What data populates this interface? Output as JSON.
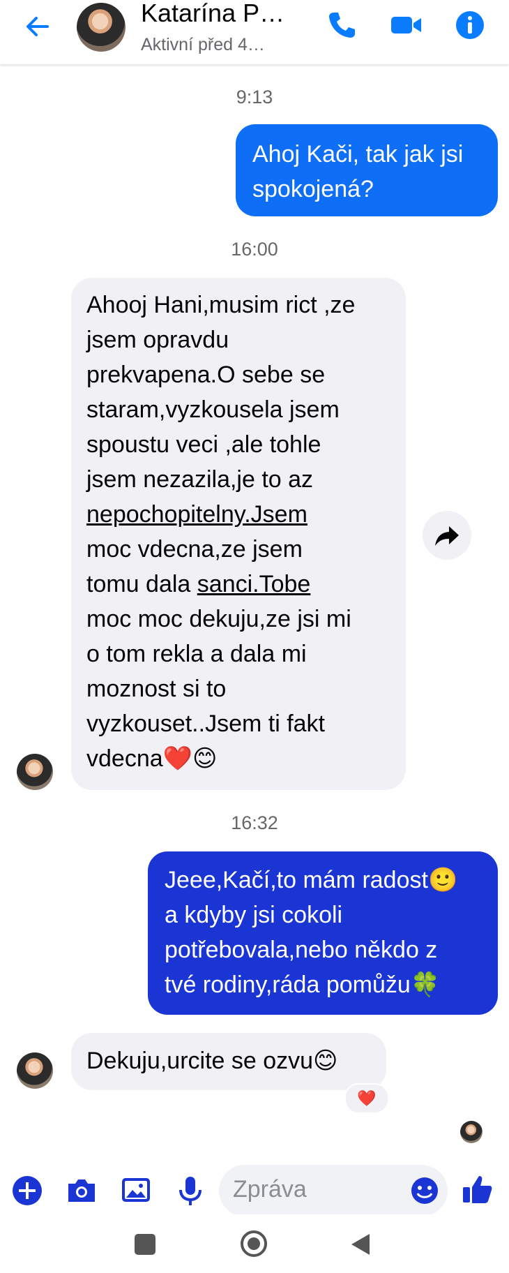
{
  "header": {
    "contact_name": "Katarína P…",
    "status": "Aktivní před 4…",
    "icons": [
      "back-arrow-icon",
      "phone-icon",
      "video-camera-icon",
      "info-icon"
    ],
    "accent_color": "#0a7cff"
  },
  "messages": [
    {
      "timestamp": "9:13"
    },
    {
      "direction": "outgoing",
      "lines": [
        "Ahoj Kači, tak jak jsi",
        "spokojená?"
      ]
    },
    {
      "timestamp": "16:00"
    },
    {
      "direction": "incoming",
      "lines": [
        "Ahooj Hani,musim rict ,ze",
        "jsem opravdu",
        "prekvapena.O sebe se",
        "staram,vyzkousela jsem",
        "spoustu veci ,ale tohle",
        "jsem nezazila,je to az",
        "nepochopitelny.Jsem",
        "moc vdecna,ze jsem",
        "tomu dala",
        "sanci.Tobe",
        "moc moc dekuju,ze jsi mi",
        "o tom rekla a dala mi",
        "moznost si to",
        "vyzkouset..Jsem ti fakt",
        "vdecna❤️😊"
      ]
    },
    {
      "timestamp": "16:32"
    },
    {
      "direction": "outgoing",
      "lines": [
        "Jeee,Kačí,to mám radost🙂",
        "a kdyby jsi cokoli",
        "potřebovala,nebo někdo z",
        "tvé rodiny,ráda pomůžu🍀"
      ]
    },
    {
      "direction": "incoming",
      "lines": [
        "Dekuju,urcite se ozvu😊"
      ],
      "reaction": "❤️"
    }
  ],
  "composer": {
    "placeholder": "Zpráva",
    "icons": [
      "plus-icon",
      "camera-icon",
      "gallery-icon",
      "microphone-icon",
      "emoji-icon",
      "like-thumb-icon"
    ]
  },
  "system_nav": {
    "icons": [
      "recents-square-icon",
      "home-circle-icon",
      "back-triangle-icon"
    ]
  }
}
